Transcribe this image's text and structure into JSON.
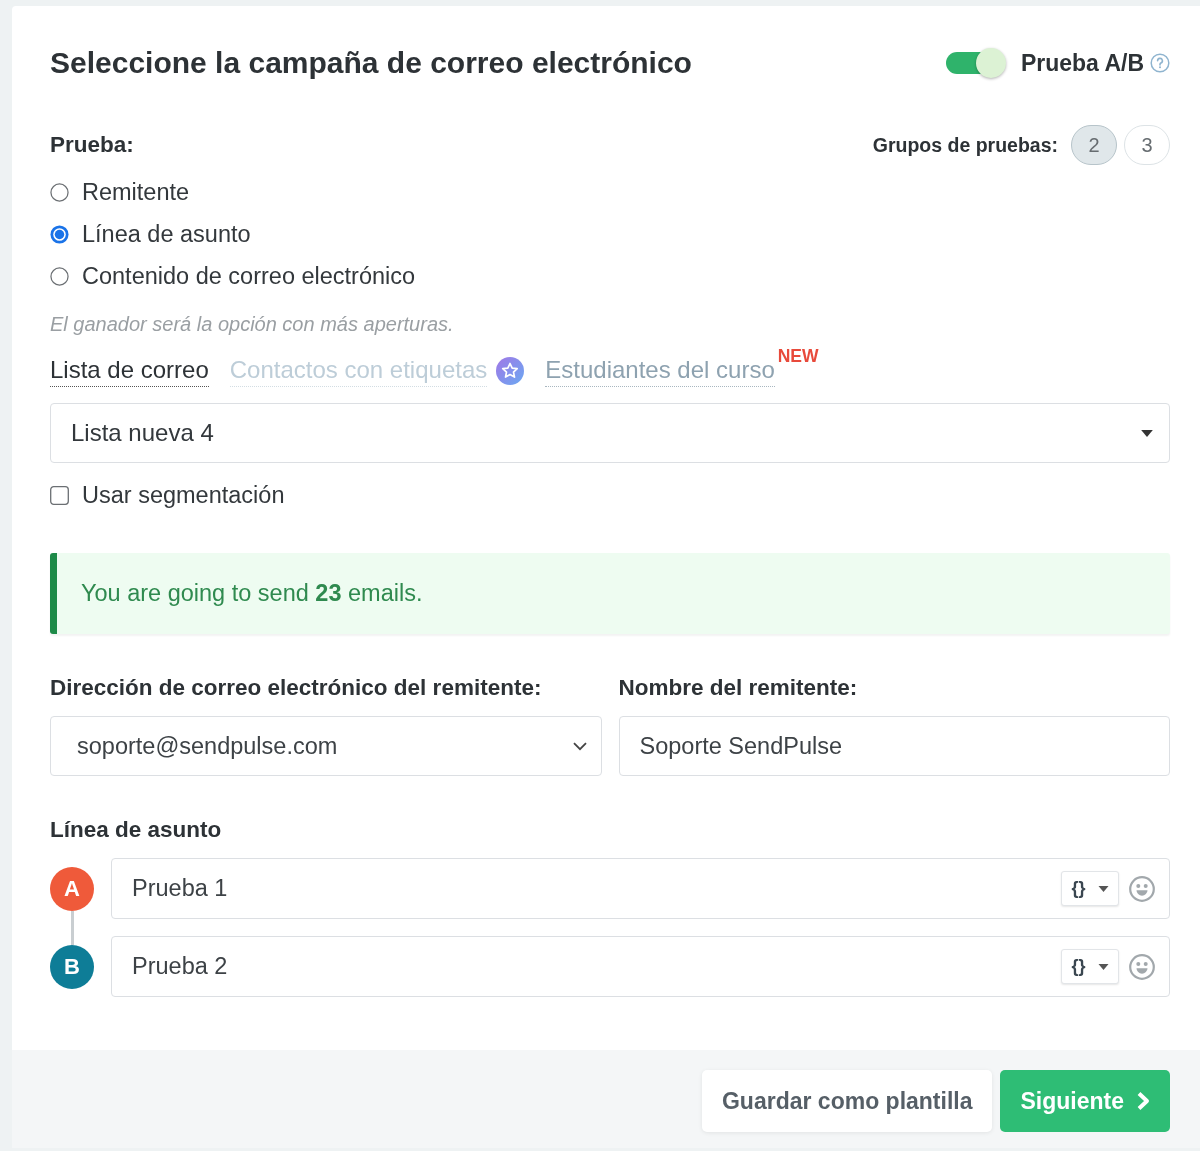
{
  "header": {
    "title": "Seleccione la campaña de correo electrónico",
    "ab_toggle": {
      "label": "Prueba A/B",
      "on": true
    }
  },
  "test": {
    "label": "Prueba:",
    "groups_label": "Grupos de pruebas:",
    "groups": [
      {
        "label": "2",
        "selected": true
      },
      {
        "label": "3",
        "selected": false
      }
    ],
    "options": [
      {
        "label": "Remitente",
        "selected": false
      },
      {
        "label": "Línea de asunto",
        "selected": true
      },
      {
        "label": "Contenido de correo electrónico",
        "selected": false
      }
    ],
    "hint": "El ganador será la opción con más aperturas."
  },
  "source_tabs": [
    {
      "label": "Lista de correo",
      "selected": true,
      "disabled": false,
      "starred": false
    },
    {
      "label": "Contactos con etiquetas",
      "selected": false,
      "disabled": true,
      "starred": true
    },
    {
      "label": "Estudiantes del curso",
      "selected": false,
      "disabled": false,
      "starred": false,
      "badge": "NEW"
    }
  ],
  "list_select": {
    "value": "Lista nueva 4"
  },
  "segmentation": {
    "label": "Usar segmentación",
    "checked": false
  },
  "notice": {
    "text": "You are going to send **23** emails."
  },
  "sender": {
    "email": {
      "label": "Dirección de correo electrónico del remitente:",
      "value": "soporte@sendpulse.com"
    },
    "name": {
      "label": "Nombre del remitente:",
      "value": "Soporte SendPulse"
    }
  },
  "subject": {
    "label": "Línea de asunto",
    "variants": [
      {
        "marker": "A",
        "color": "#ef5a3a",
        "value": "Prueba 1",
        "variable_button": "{}"
      },
      {
        "marker": "B",
        "color": "#0e7d97",
        "value": "Prueba 2",
        "variable_button": "{}"
      }
    ]
  },
  "footer": {
    "buttons": [
      {
        "label": "Guardar como plantilla",
        "kind": "secondary"
      },
      {
        "label": "Siguiente",
        "kind": "primary"
      }
    ]
  }
}
